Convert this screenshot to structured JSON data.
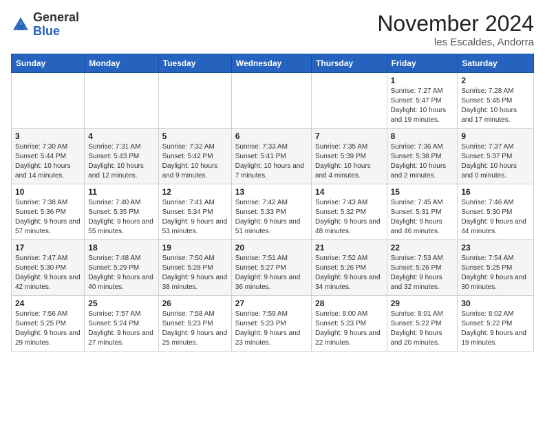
{
  "header": {
    "logo_general": "General",
    "logo_blue": "Blue",
    "title": "November 2024",
    "subtitle": "les Escaldes, Andorra"
  },
  "columns": [
    "Sunday",
    "Monday",
    "Tuesday",
    "Wednesday",
    "Thursday",
    "Friday",
    "Saturday"
  ],
  "weeks": [
    [
      {
        "day": "",
        "info": ""
      },
      {
        "day": "",
        "info": ""
      },
      {
        "day": "",
        "info": ""
      },
      {
        "day": "",
        "info": ""
      },
      {
        "day": "",
        "info": ""
      },
      {
        "day": "1",
        "info": "Sunrise: 7:27 AM\nSunset: 5:47 PM\nDaylight: 10 hours and 19 minutes."
      },
      {
        "day": "2",
        "info": "Sunrise: 7:28 AM\nSunset: 5:45 PM\nDaylight: 10 hours and 17 minutes."
      }
    ],
    [
      {
        "day": "3",
        "info": "Sunrise: 7:30 AM\nSunset: 5:44 PM\nDaylight: 10 hours and 14 minutes."
      },
      {
        "day": "4",
        "info": "Sunrise: 7:31 AM\nSunset: 5:43 PM\nDaylight: 10 hours and 12 minutes."
      },
      {
        "day": "5",
        "info": "Sunrise: 7:32 AM\nSunset: 5:42 PM\nDaylight: 10 hours and 9 minutes."
      },
      {
        "day": "6",
        "info": "Sunrise: 7:33 AM\nSunset: 5:41 PM\nDaylight: 10 hours and 7 minutes."
      },
      {
        "day": "7",
        "info": "Sunrise: 7:35 AM\nSunset: 5:39 PM\nDaylight: 10 hours and 4 minutes."
      },
      {
        "day": "8",
        "info": "Sunrise: 7:36 AM\nSunset: 5:38 PM\nDaylight: 10 hours and 2 minutes."
      },
      {
        "day": "9",
        "info": "Sunrise: 7:37 AM\nSunset: 5:37 PM\nDaylight: 10 hours and 0 minutes."
      }
    ],
    [
      {
        "day": "10",
        "info": "Sunrise: 7:38 AM\nSunset: 5:36 PM\nDaylight: 9 hours and 57 minutes."
      },
      {
        "day": "11",
        "info": "Sunrise: 7:40 AM\nSunset: 5:35 PM\nDaylight: 9 hours and 55 minutes."
      },
      {
        "day": "12",
        "info": "Sunrise: 7:41 AM\nSunset: 5:34 PM\nDaylight: 9 hours and 53 minutes."
      },
      {
        "day": "13",
        "info": "Sunrise: 7:42 AM\nSunset: 5:33 PM\nDaylight: 9 hours and 51 minutes."
      },
      {
        "day": "14",
        "info": "Sunrise: 7:43 AM\nSunset: 5:32 PM\nDaylight: 9 hours and 48 minutes."
      },
      {
        "day": "15",
        "info": "Sunrise: 7:45 AM\nSunset: 5:31 PM\nDaylight: 9 hours and 46 minutes."
      },
      {
        "day": "16",
        "info": "Sunrise: 7:46 AM\nSunset: 5:30 PM\nDaylight: 9 hours and 44 minutes."
      }
    ],
    [
      {
        "day": "17",
        "info": "Sunrise: 7:47 AM\nSunset: 5:30 PM\nDaylight: 9 hours and 42 minutes."
      },
      {
        "day": "18",
        "info": "Sunrise: 7:48 AM\nSunset: 5:29 PM\nDaylight: 9 hours and 40 minutes."
      },
      {
        "day": "19",
        "info": "Sunrise: 7:50 AM\nSunset: 5:28 PM\nDaylight: 9 hours and 38 minutes."
      },
      {
        "day": "20",
        "info": "Sunrise: 7:51 AM\nSunset: 5:27 PM\nDaylight: 9 hours and 36 minutes."
      },
      {
        "day": "21",
        "info": "Sunrise: 7:52 AM\nSunset: 5:26 PM\nDaylight: 9 hours and 34 minutes."
      },
      {
        "day": "22",
        "info": "Sunrise: 7:53 AM\nSunset: 5:26 PM\nDaylight: 9 hours and 32 minutes."
      },
      {
        "day": "23",
        "info": "Sunrise: 7:54 AM\nSunset: 5:25 PM\nDaylight: 9 hours and 30 minutes."
      }
    ],
    [
      {
        "day": "24",
        "info": "Sunrise: 7:56 AM\nSunset: 5:25 PM\nDaylight: 9 hours and 29 minutes."
      },
      {
        "day": "25",
        "info": "Sunrise: 7:57 AM\nSunset: 5:24 PM\nDaylight: 9 hours and 27 minutes."
      },
      {
        "day": "26",
        "info": "Sunrise: 7:58 AM\nSunset: 5:23 PM\nDaylight: 9 hours and 25 minutes."
      },
      {
        "day": "27",
        "info": "Sunrise: 7:59 AM\nSunset: 5:23 PM\nDaylight: 9 hours and 23 minutes."
      },
      {
        "day": "28",
        "info": "Sunrise: 8:00 AM\nSunset: 5:23 PM\nDaylight: 9 hours and 22 minutes."
      },
      {
        "day": "29",
        "info": "Sunrise: 8:01 AM\nSunset: 5:22 PM\nDaylight: 9 hours and 20 minutes."
      },
      {
        "day": "30",
        "info": "Sunrise: 8:02 AM\nSunset: 5:22 PM\nDaylight: 9 hours and 19 minutes."
      }
    ]
  ]
}
